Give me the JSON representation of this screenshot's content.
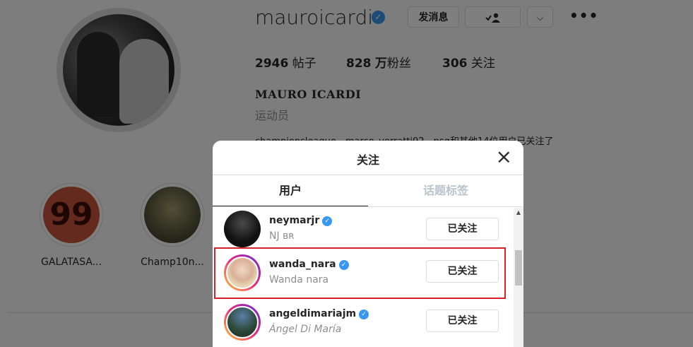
{
  "profile": {
    "username": "mauroicardi",
    "verified_mark": "✓",
    "message_button": "发消息",
    "follow_icon": "person-check-icon",
    "more_chevron": "⌵",
    "more_dots": "•••",
    "stats": {
      "posts": {
        "value": "2946",
        "label": "帖子"
      },
      "followers": {
        "value": "828",
        "unit": "万",
        "label": "粉丝"
      },
      "following": {
        "value": "306",
        "label": "关注"
      }
    },
    "full_name": "MAURO ICARDI",
    "category": "运动员",
    "followed_by": "championsleague、marco_verratti92、psg和其他14位用户已关注了"
  },
  "highlights": [
    {
      "label": "GALATASA...",
      "cover_text": "99"
    },
    {
      "label": "Champ10n..."
    }
  ],
  "modal": {
    "title": "关注",
    "close_icon": "×",
    "tabs": [
      {
        "label": "用户",
        "active": true
      },
      {
        "label": "话题标签",
        "active": false
      }
    ],
    "users": [
      {
        "username": "neymarjr",
        "verified": true,
        "subtitle": "NJ ʙʀ",
        "button": "已关注"
      },
      {
        "username": "wanda_nara",
        "verified": true,
        "subtitle": "Wanda nara",
        "button": "已关注"
      },
      {
        "username": "angeldimariajm",
        "verified": true,
        "subtitle": "Ángel Di María",
        "button": "已关注"
      }
    ],
    "scroll_up_arrow": "▲"
  },
  "colors": {
    "verified": "#3897f0",
    "highlight_outline": "#d6202a",
    "overlay": "rgba(0,0,0,0.5)"
  }
}
